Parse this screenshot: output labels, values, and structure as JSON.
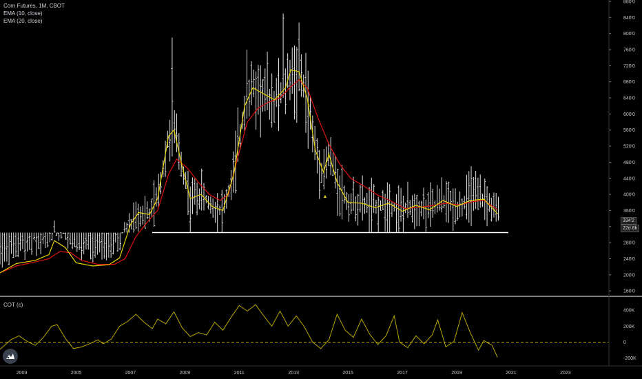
{
  "legend": {
    "symbol": "Corn Futures, 1M, CBOT",
    "ema10": "EMA (10, close)",
    "ema20": "EMA (20, close)",
    "cot": "COT (c)"
  },
  "price_tag": "334'2",
  "countdown_tag": "22d 8h",
  "colors": {
    "background": "#000000",
    "bars": "#e0e0e0",
    "ema10": "#e6d200",
    "ema20": "#e01010",
    "cot": "#b8a800",
    "support": "#ffffff",
    "pane_divider": "#ffffff"
  },
  "chart_data": [
    {
      "type": "line",
      "title": "Corn Futures, 1M, CBOT",
      "x_axis": {
        "labels": [
          "2003",
          "2005",
          "2007",
          "2009",
          "2011",
          "2013",
          "2015",
          "2017",
          "2019",
          "2021",
          "2023"
        ],
        "range": [
          2002.2,
          2024.6
        ]
      },
      "y_axis": {
        "labels": [
          "160'0",
          "200'0",
          "240'0",
          "280'0",
          "320'0",
          "360'0",
          "400'0",
          "440'0",
          "480'0",
          "520'0",
          "560'0",
          "600'0",
          "640'0",
          "680'0",
          "720'0",
          "760'0",
          "800'0",
          "840'0",
          "880'0"
        ],
        "ylim": [
          150,
          880
        ],
        "side": "right"
      },
      "series": [
        {
          "name": "EMA (10, close)",
          "points": [
            [
              2002.2,
              205
            ],
            [
              2002.8,
              228
            ],
            [
              2003.5,
              236
            ],
            [
              2004.0,
              250
            ],
            [
              2004.2,
              285
            ],
            [
              2004.6,
              268
            ],
            [
              2005.0,
              230
            ],
            [
              2005.6,
              222
            ],
            [
              2006.2,
              225
            ],
            [
              2006.6,
              242
            ],
            [
              2007.0,
              325
            ],
            [
              2007.3,
              355
            ],
            [
              2007.7,
              350
            ],
            [
              2008.0,
              390
            ],
            [
              2008.4,
              545
            ],
            [
              2008.6,
              560
            ],
            [
              2008.9,
              470
            ],
            [
              2009.2,
              390
            ],
            [
              2009.6,
              400
            ],
            [
              2010.0,
              370
            ],
            [
              2010.4,
              360
            ],
            [
              2010.8,
              450
            ],
            [
              2011.2,
              620
            ],
            [
              2011.5,
              665
            ],
            [
              2011.9,
              650
            ],
            [
              2012.3,
              635
            ],
            [
              2012.7,
              665
            ],
            [
              2012.9,
              710
            ],
            [
              2013.2,
              705
            ],
            [
              2013.5,
              640
            ],
            [
              2013.8,
              510
            ],
            [
              2014.1,
              455
            ],
            [
              2014.3,
              500
            ],
            [
              2014.6,
              430
            ],
            [
              2015.0,
              380
            ],
            [
              2015.5,
              378
            ],
            [
              2016.0,
              367
            ],
            [
              2016.5,
              378
            ],
            [
              2017.0,
              358
            ],
            [
              2017.5,
              373
            ],
            [
              2018.0,
              362
            ],
            [
              2018.5,
              385
            ],
            [
              2019.0,
              370
            ],
            [
              2019.5,
              385
            ],
            [
              2020.0,
              388
            ],
            [
              2020.5,
              352
            ]
          ]
        },
        {
          "name": "EMA (20, close)",
          "points": [
            [
              2002.2,
              205
            ],
            [
              2002.8,
              222
            ],
            [
              2003.5,
              232
            ],
            [
              2004.0,
              240
            ],
            [
              2004.4,
              258
            ],
            [
              2004.8,
              255
            ],
            [
              2005.2,
              236
            ],
            [
              2005.8,
              226
            ],
            [
              2006.4,
              226
            ],
            [
              2006.8,
              240
            ],
            [
              2007.2,
              295
            ],
            [
              2007.6,
              330
            ],
            [
              2008.0,
              360
            ],
            [
              2008.4,
              450
            ],
            [
              2008.7,
              488
            ],
            [
              2009.1,
              465
            ],
            [
              2009.5,
              430
            ],
            [
              2009.9,
              400
            ],
            [
              2010.3,
              385
            ],
            [
              2010.6,
              400
            ],
            [
              2010.9,
              480
            ],
            [
              2011.3,
              580
            ],
            [
              2011.7,
              615
            ],
            [
              2012.1,
              630
            ],
            [
              2012.5,
              640
            ],
            [
              2012.9,
              668
            ],
            [
              2013.2,
              685
            ],
            [
              2013.5,
              665
            ],
            [
              2013.9,
              590
            ],
            [
              2014.3,
              525
            ],
            [
              2014.7,
              475
            ],
            [
              2015.1,
              440
            ],
            [
              2015.6,
              420
            ],
            [
              2016.1,
              398
            ],
            [
              2016.6,
              383
            ],
            [
              2017.1,
              365
            ],
            [
              2017.6,
              368
            ],
            [
              2018.1,
              372
            ],
            [
              2018.6,
              378
            ],
            [
              2019.1,
              374
            ],
            [
              2019.6,
              382
            ],
            [
              2020.0,
              385
            ],
            [
              2020.5,
              362
            ]
          ]
        }
      ],
      "support_level": 305,
      "annotation": "▲"
    },
    {
      "type": "line",
      "title": "COT (c)",
      "y_axis": {
        "labels": [
          "400K",
          "200K",
          "0",
          "-200K"
        ],
        "ylim": [
          -280000,
          540000
        ],
        "side": "right"
      },
      "zero_line": 0,
      "series": [
        {
          "name": "COT (c)",
          "points": [
            [
              2002.2,
              -90000
            ],
            [
              2002.6,
              30000
            ],
            [
              2002.9,
              80000
            ],
            [
              2003.2,
              10000
            ],
            [
              2003.5,
              -40000
            ],
            [
              2003.8,
              60000
            ],
            [
              2004.1,
              200000
            ],
            [
              2004.3,
              220000
            ],
            [
              2004.6,
              50000
            ],
            [
              2004.9,
              -80000
            ],
            [
              2005.2,
              -60000
            ],
            [
              2005.5,
              -20000
            ],
            [
              2005.8,
              30000
            ],
            [
              2006.0,
              -20000
            ],
            [
              2006.3,
              40000
            ],
            [
              2006.6,
              200000
            ],
            [
              2006.9,
              260000
            ],
            [
              2007.2,
              350000
            ],
            [
              2007.5,
              250000
            ],
            [
              2007.8,
              170000
            ],
            [
              2008.0,
              290000
            ],
            [
              2008.3,
              230000
            ],
            [
              2008.6,
              380000
            ],
            [
              2008.9,
              180000
            ],
            [
              2009.2,
              70000
            ],
            [
              2009.5,
              120000
            ],
            [
              2009.8,
              90000
            ],
            [
              2010.1,
              250000
            ],
            [
              2010.4,
              150000
            ],
            [
              2010.7,
              310000
            ],
            [
              2011.0,
              460000
            ],
            [
              2011.3,
              390000
            ],
            [
              2011.6,
              470000
            ],
            [
              2011.9,
              330000
            ],
            [
              2012.2,
              200000
            ],
            [
              2012.5,
              390000
            ],
            [
              2012.8,
              200000
            ],
            [
              2013.1,
              330000
            ],
            [
              2013.4,
              190000
            ],
            [
              2013.7,
              0
            ],
            [
              2014.0,
              -80000
            ],
            [
              2014.3,
              30000
            ],
            [
              2014.6,
              350000
            ],
            [
              2014.9,
              150000
            ],
            [
              2015.2,
              60000
            ],
            [
              2015.5,
              290000
            ],
            [
              2015.8,
              100000
            ],
            [
              2016.1,
              -30000
            ],
            [
              2016.4,
              80000
            ],
            [
              2016.7,
              330000
            ],
            [
              2016.9,
              0
            ],
            [
              2017.2,
              -70000
            ],
            [
              2017.5,
              80000
            ],
            [
              2017.8,
              -20000
            ],
            [
              2018.1,
              90000
            ],
            [
              2018.3,
              280000
            ],
            [
              2018.6,
              -60000
            ],
            [
              2018.9,
              10000
            ],
            [
              2019.2,
              370000
            ],
            [
              2019.5,
              120000
            ],
            [
              2019.8,
              -100000
            ],
            [
              2020.0,
              20000
            ],
            [
              2020.3,
              -40000
            ],
            [
              2020.5,
              -190000
            ]
          ]
        }
      ]
    }
  ]
}
